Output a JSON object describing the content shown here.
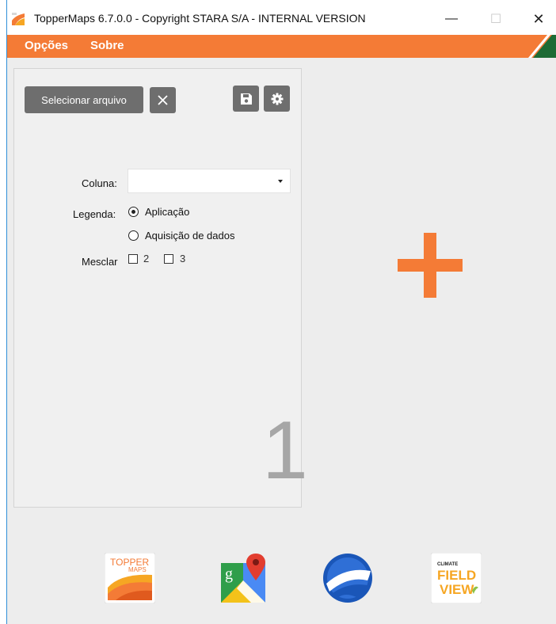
{
  "window": {
    "title": "TopperMaps 6.7.0.0 - Copyright STARA S/A  - INTERNAL VERSION",
    "minimize_glyph": "—",
    "maximize_glyph": "☐",
    "close_glyph": "✕"
  },
  "menu": {
    "items": [
      {
        "label": "Opções"
      },
      {
        "label": "Sobre"
      }
    ]
  },
  "panel1": {
    "select_file_label": "Selecionar arquivo",
    "clear_icon": "close-icon",
    "save_icon": "floppy-disk-icon",
    "settings_icon": "gear-icon",
    "coluna_label": "Coluna:",
    "coluna_value": "",
    "legenda_label": "Legenda:",
    "legenda_options": [
      {
        "label": "Aplicação",
        "checked": true
      },
      {
        "label": "Aquisição de dados",
        "checked": false
      }
    ],
    "mesclar_label": "Mesclar",
    "mesclar_options": [
      {
        "label": "2",
        "checked": false
      },
      {
        "label": "3",
        "checked": false
      }
    ],
    "panel_number": "1"
  },
  "add_panel": {
    "icon": "plus-icon"
  },
  "integrations": [
    {
      "name": "toppermaps",
      "logo_text_top": "TOPPER",
      "logo_text_bottom": "MAPS"
    },
    {
      "name": "google-maps",
      "logo_text": "g"
    },
    {
      "name": "google-earth"
    },
    {
      "name": "climate-fieldview",
      "logo_text_small": "CLIMATE",
      "logo_text_1": "FIELD",
      "logo_text_2": "VIEW"
    }
  ],
  "colors": {
    "accent_orange": "#f47b36",
    "button_gray": "#6e6e6e",
    "brand_green": "#1e6b35",
    "panel_number_gray": "#a6a6a6"
  }
}
